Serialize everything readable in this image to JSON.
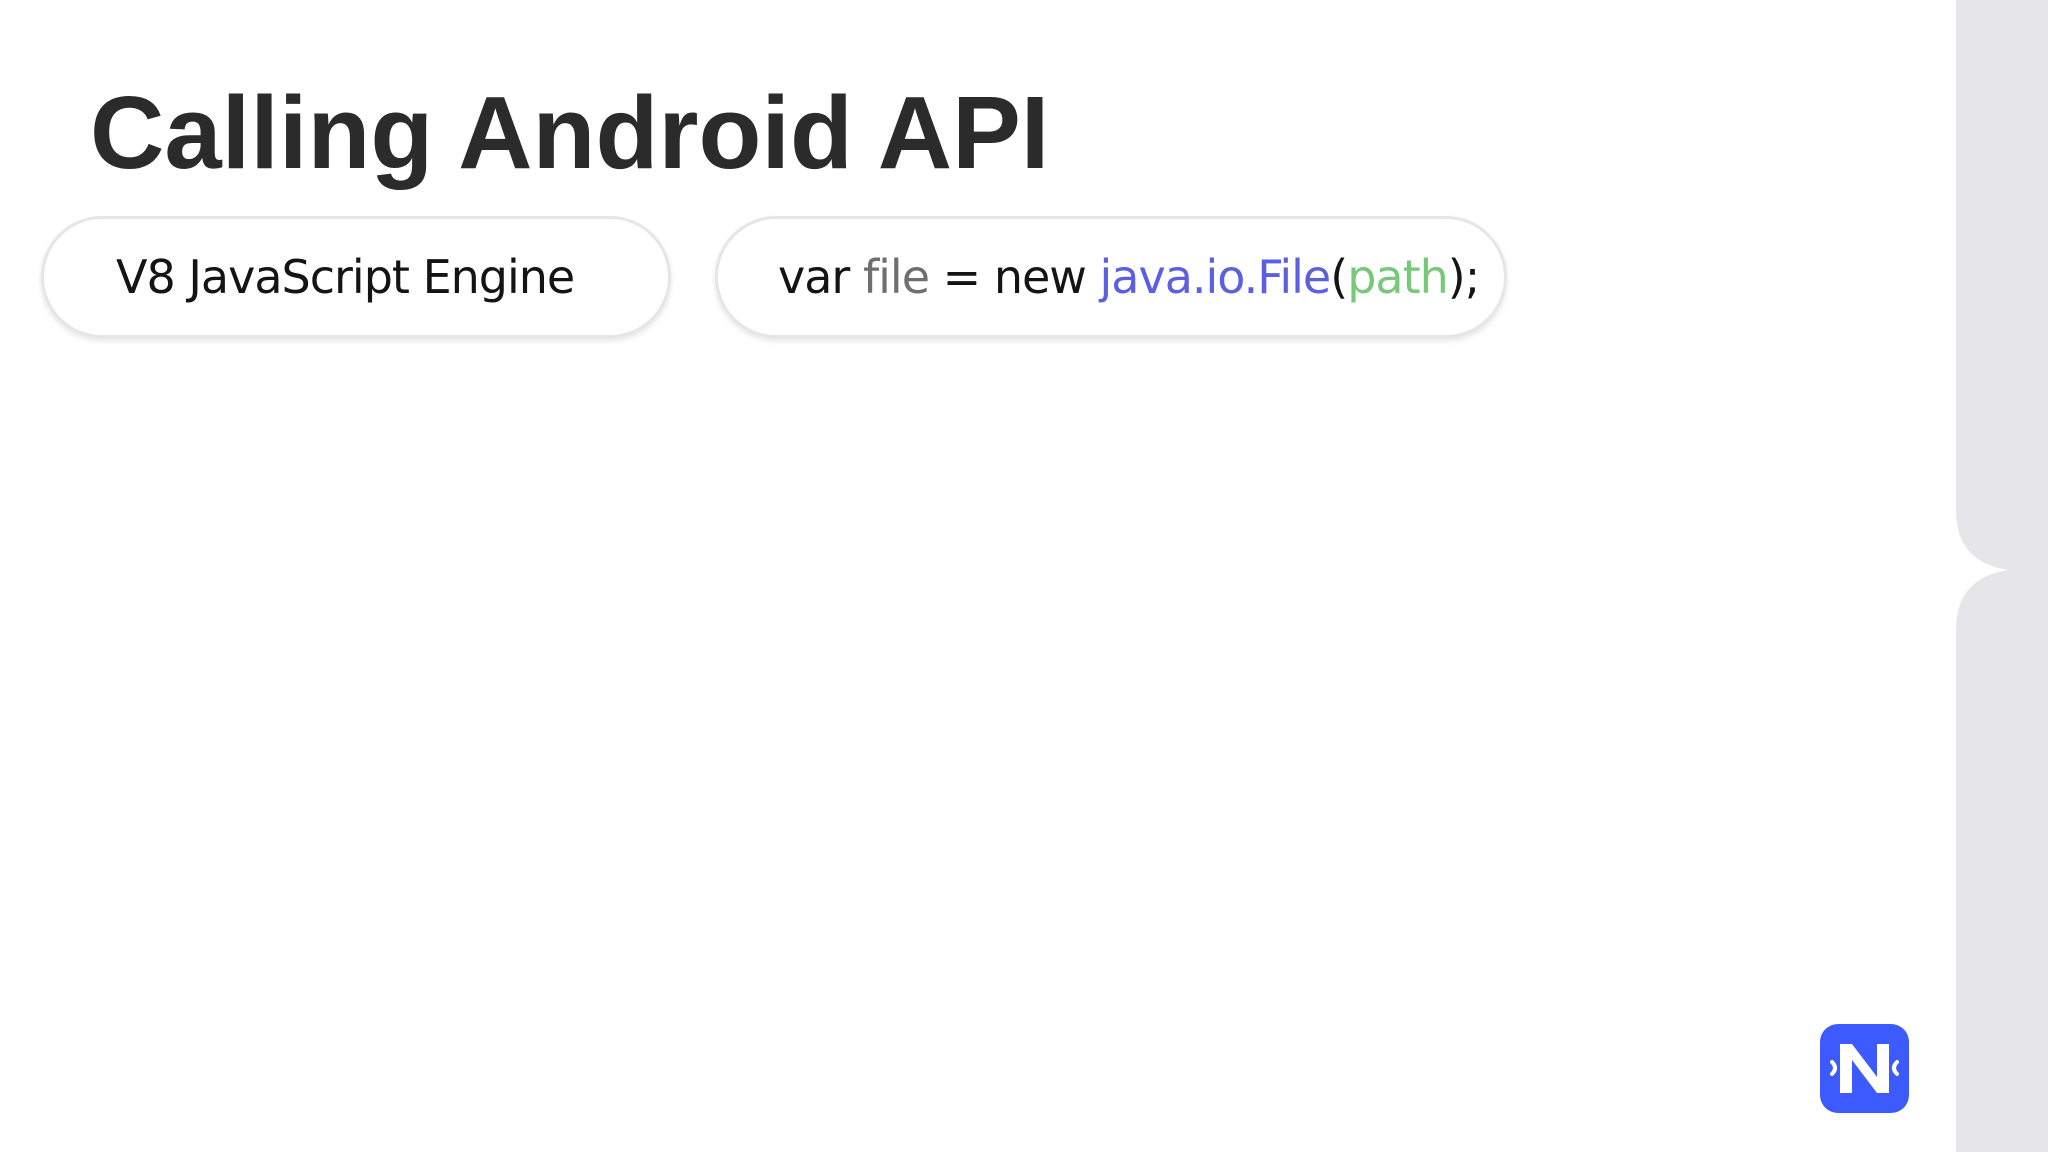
{
  "slide": {
    "title": "Calling Android API"
  },
  "pills": {
    "engine_label": "V8 JavaScript Engine",
    "code": {
      "keyword_var": "var ",
      "identifier": "file",
      "assign": " = ",
      "keyword_new": "new ",
      "namespace": "java.io.File",
      "open_paren": "(",
      "argument": "path",
      "close_paren": ");"
    }
  },
  "colors": {
    "title": "#2b2b2b",
    "text": "#141414",
    "identifier": "#6f6f6f",
    "namespace": "#5b5fe0",
    "argument": "#79c879",
    "logo": "#3d5afe",
    "side_panel": "#e6e6e8"
  },
  "logo": {
    "icon": "nativescript-logo-icon"
  }
}
